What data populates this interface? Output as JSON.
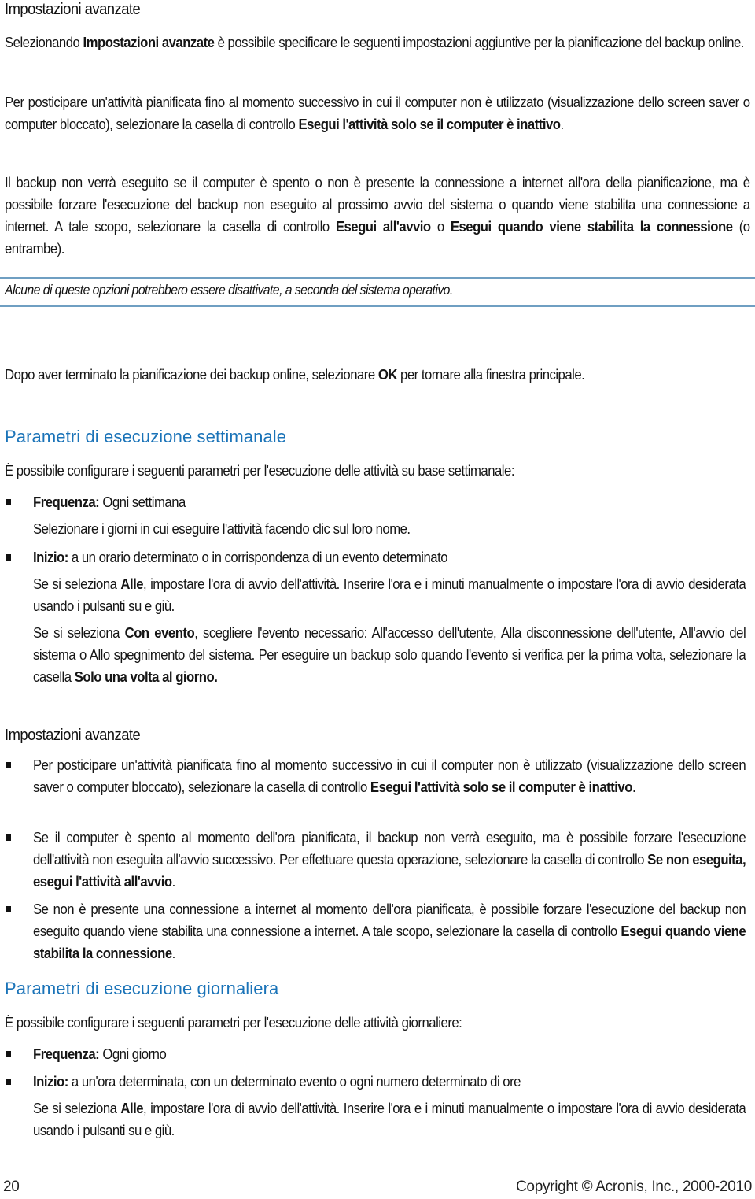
{
  "section_advanced_1": {
    "heading": "Impostazioni avanzate",
    "intro_pre": "Selezionando ",
    "intro_bold": "Impostazioni avanzate",
    "intro_post": " è possibile specificare le seguenti impostazioni aggiuntive per la pianificazione del backup online.",
    "p1_pre": "Per posticipare un'attività pianificata fino al momento successivo in cui il computer non è utilizzato (visualizzazione dello screen saver o computer bloccato), selezionare la casella di controllo ",
    "p1_bold": "Esegui l'attività solo se il computer è inattivo",
    "p1_post": ".",
    "p2_pre": "Il backup non verrà eseguito se il computer è spento o non è presente la connessione a internet all'ora della pianificazione, ma è possibile forzare l'esecuzione del backup non eseguito al prossimo avvio del sistema o quando viene stabilita una connessione a internet. A tale scopo, selezionare la casella di controllo ",
    "p2_bold1": "Esegui all'avvio",
    "p2_mid": " o ",
    "p2_bold2": "Esegui quando viene stabilita la connessione",
    "p2_post": " (o entrambe).",
    "note": "Alcune di queste opzioni potrebbero essere disattivate, a seconda del sistema operativo.",
    "p3_pre": "Dopo aver terminato la pianificazione dei backup online, selezionare ",
    "p3_bold": "OK",
    "p3_post": " per tornare alla finestra principale."
  },
  "section_weekly": {
    "heading": "Parametri di esecuzione settimanale",
    "intro": "È possibile configurare i seguenti parametri per l'esecuzione delle attività su base settimanale:",
    "frequency_label": "Frequenza:",
    "frequency_value": " Ogni settimana",
    "frequency_detail": "Selezionare i giorni in cui eseguire l'attività facendo clic sul loro nome.",
    "start_label": "Inizio:",
    "start_value": " a un orario determinato o in corrispondenza di un evento determinato",
    "start_detail1_pre": "Se si seleziona ",
    "start_detail1_bold": "Alle",
    "start_detail1_post": ", impostare l'ora di avvio dell'attività. Inserire l'ora e i minuti manualmente o impostare l'ora di avvio desiderata usando i pulsanti su e giù.",
    "start_detail2_pre": "Se si seleziona ",
    "start_detail2_bold": "Con evento",
    "start_detail2_mid": ", scegliere l'evento necessario: All'accesso dell'utente, Alla disconnessione dell'utente, All'avvio del sistema o Allo spegnimento del sistema. Per eseguire un backup solo quando l'evento si verifica per la prima volta, selezionare la casella ",
    "start_detail2_bold2": "Solo una volta al giorno."
  },
  "section_advanced_2": {
    "heading": "Impostazioni avanzate",
    "items": [
      {
        "pre": "Per posticipare un'attività pianificata fino al momento successivo in cui il computer non è utilizzato (visualizzazione dello screen saver o computer bloccato), selezionare la casella di controllo ",
        "bold": "Esegui l'attività solo se il computer è inattivo",
        "post": "."
      },
      {
        "pre": "Se il computer è spento al momento dell'ora pianificata, il backup non verrà eseguito, ma è possibile forzare l'esecuzione dell'attività non eseguita all'avvio successivo. Per effettuare questa operazione, selezionare la casella di controllo ",
        "bold": "Se non eseguita, esegui l'attività all'avvio",
        "post": "."
      },
      {
        "pre": "Se non è presente una connessione a internet al momento dell'ora pianificata, è possibile forzare l'esecuzione del backup non eseguito quando viene stabilita una connessione a internet. A tale scopo, selezionare la casella di controllo ",
        "bold": "Esegui quando viene stabilita la connessione",
        "post": "."
      }
    ]
  },
  "section_daily": {
    "heading": "Parametri di esecuzione giornaliera",
    "intro": "È possibile configurare i seguenti parametri per l'esecuzione delle attività giornaliere:",
    "frequency_label": "Frequenza:",
    "frequency_value": " Ogni giorno",
    "start_label": "Inizio:",
    "start_value": " a un'ora determinata, con un determinato evento o ogni numero determinato di ore",
    "start_detail_pre": "Se si seleziona ",
    "start_detail_bold": "Alle",
    "start_detail_post": ", impostare l'ora di avvio dell'attività. Inserire l'ora e i minuti manualmente o impostare l'ora di avvio desiderata usando i pulsanti su e giù."
  },
  "footer": {
    "page_number": "20",
    "copyright": "Copyright © Acronis, Inc., 2000-2010"
  },
  "colors": {
    "heading_blue": "#1a73b8",
    "rule_blue": "#6f9fc2"
  }
}
